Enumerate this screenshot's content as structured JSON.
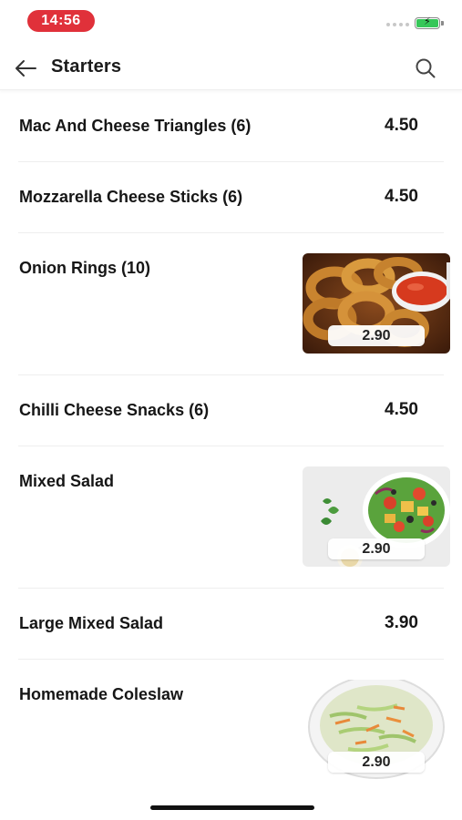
{
  "status_bar": {
    "time": "14:56"
  },
  "header": {
    "title": "Starters",
    "back_icon": "arrow-left-icon",
    "search_icon": "search-icon"
  },
  "items": [
    {
      "name": "Mac And Cheese Triangles (6)",
      "price": "4.50"
    },
    {
      "name": "Mozzarella Cheese Sticks (6)",
      "price": "4.50"
    },
    {
      "name": "Onion Rings (10)",
      "price": "2.90",
      "image": "onion-rings-photo"
    },
    {
      "name": "Chilli Cheese Snacks (6)",
      "price": "4.50"
    },
    {
      "name": "Mixed Salad",
      "price": "2.90",
      "image": "mixed-salad-photo"
    },
    {
      "name": "Large Mixed Salad",
      "price": "3.90"
    },
    {
      "name": "Homemade Coleslaw",
      "price": "2.90",
      "image": "coleslaw-photo"
    }
  ],
  "colors": {
    "time_pill": "#e0313a",
    "battery_fill": "#36c759",
    "text": "#161616",
    "divider": "#eeeeee"
  }
}
